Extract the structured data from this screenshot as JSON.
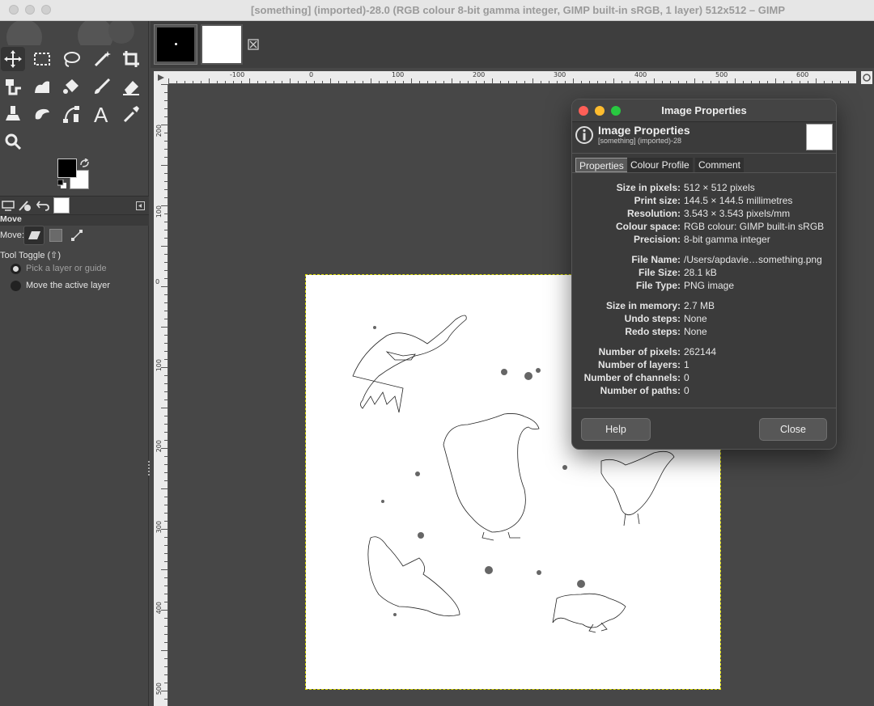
{
  "window": {
    "title": "[something] (imported)-28.0 (RGB colour 8-bit gamma integer, GIMP built-in sRGB, 1 layer) 512x512 – GIMP"
  },
  "tool_options": {
    "title": "Move",
    "move_label": "Move:",
    "toggle_label": "Tool Toggle  (⇧)",
    "option1": "Pick a layer or guide",
    "option2": "Move the active layer"
  },
  "ruler": {
    "h_labels": [
      "-100",
      "0",
      "100",
      "200",
      "300",
      "400",
      "500",
      "600"
    ],
    "v_labels": [
      "200",
      "100",
      "0",
      "100",
      "200",
      "300",
      "400",
      "500"
    ]
  },
  "dialog": {
    "window_title": "Image Properties",
    "header_title": "Image Properties",
    "header_subtitle": "[something] (imported)-28",
    "tabs": [
      "Properties",
      "Colour Profile",
      "Comment"
    ],
    "props": [
      {
        "k": "Size in pixels:",
        "v": "512 × 512 pixels"
      },
      {
        "k": "Print size:",
        "v": "144.5 × 144.5 millimetres"
      },
      {
        "k": "Resolution:",
        "v": "3.543 × 3.543 pixels/mm"
      },
      {
        "k": "Colour space:",
        "v": "RGB colour: GIMP built-in sRGB"
      },
      {
        "k": "Precision:",
        "v": "8-bit gamma integer"
      },
      {
        "k": "File Name:",
        "v": "/Users/apdavie…something.png"
      },
      {
        "k": "File Size:",
        "v": "28.1 kB"
      },
      {
        "k": "File Type:",
        "v": "PNG image"
      },
      {
        "k": "Size in memory:",
        "v": "2.7 MB"
      },
      {
        "k": "Undo steps:",
        "v": "None"
      },
      {
        "k": "Redo steps:",
        "v": "None"
      },
      {
        "k": "Number of pixels:",
        "v": "262144"
      },
      {
        "k": "Number of layers:",
        "v": "1"
      },
      {
        "k": "Number of channels:",
        "v": "0"
      },
      {
        "k": "Number of paths:",
        "v": "0"
      }
    ],
    "help_label": "Help",
    "close_label": "Close"
  }
}
